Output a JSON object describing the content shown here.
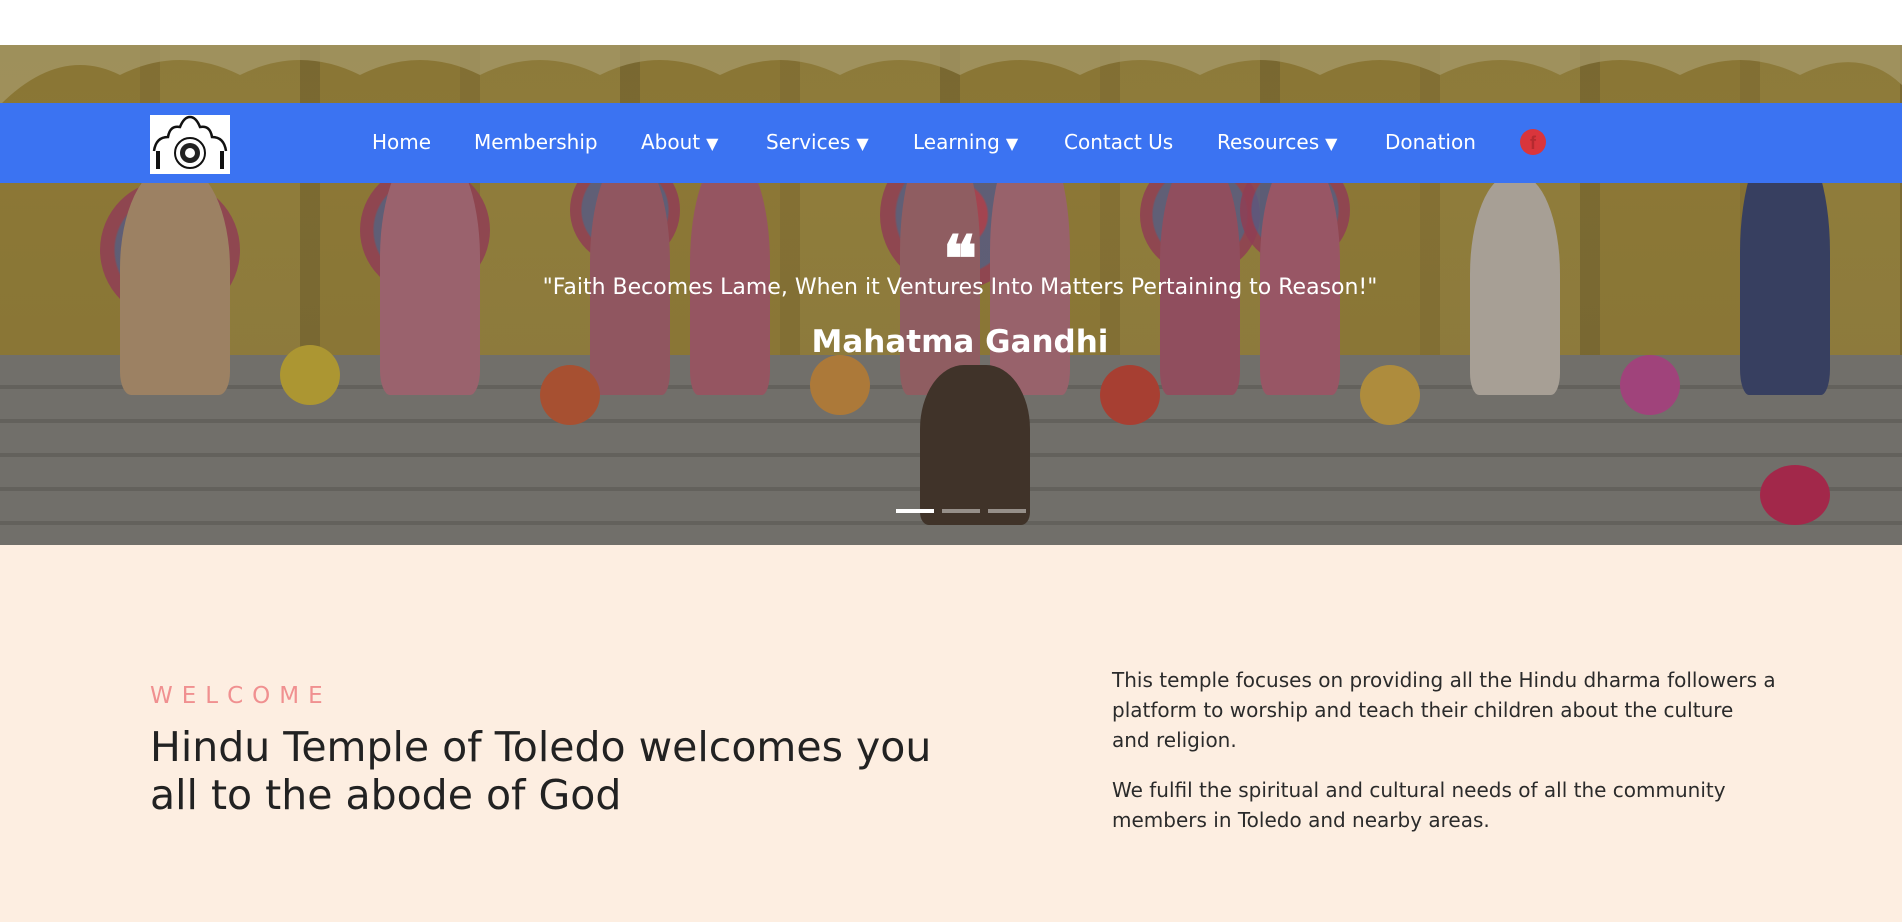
{
  "nav": {
    "logo_alt": "The Hindu Temple of Toledo logo",
    "items": [
      {
        "label": "Home",
        "has_dropdown": false
      },
      {
        "label": "Membership",
        "has_dropdown": false
      },
      {
        "label": "About",
        "has_dropdown": true
      },
      {
        "label": "Services",
        "has_dropdown": true
      },
      {
        "label": "Learning",
        "has_dropdown": true
      },
      {
        "label": "Contact Us",
        "has_dropdown": false
      },
      {
        "label": "Resources",
        "has_dropdown": true
      },
      {
        "label": "Donation",
        "has_dropdown": false
      }
    ],
    "caret": "▼",
    "social_icon": "facebook-icon",
    "social_glyph": "f"
  },
  "hero": {
    "quote_mark": "❝",
    "quote": "\"Faith Becomes Lame, When it Ventures Into Matters Pertaining to Reason!\"",
    "author": "Mahatma Gandhi",
    "slides": 3,
    "active_slide": 1
  },
  "welcome": {
    "kicker": "WELCOME",
    "headline": "Hindu Temple of Toledo welcomes you all to the abode of God",
    "paragraphs": [
      "This temple focuses on providing all the Hindu dharma followers a platform to worship and teach their children about the culture and religion.",
      "We fulfil the spiritual and cultural needs of all the community members in Toledo and nearby areas."
    ]
  },
  "colors": {
    "nav_bg": "#3b73f2",
    "section_bg": "#fdeee1",
    "kicker": "#f09090",
    "facebook": "#d9353c"
  }
}
